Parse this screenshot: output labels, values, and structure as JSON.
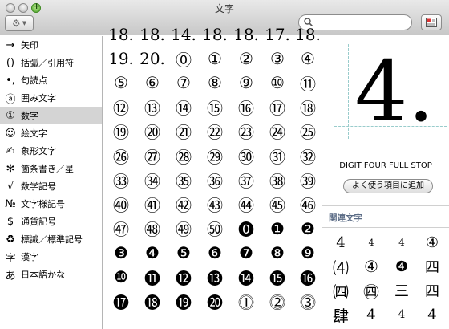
{
  "window": {
    "title": "文字"
  },
  "search": {
    "placeholder": ""
  },
  "sidebar": {
    "items": [
      {
        "icon": "→",
        "label": "矢印"
      },
      {
        "icon": "()",
        "label": "括弧／引用符"
      },
      {
        "icon": "•,",
        "label": "句読点"
      },
      {
        "icon": "ⓐ",
        "label": "囲み文字"
      },
      {
        "icon": "①",
        "label": "数字"
      },
      {
        "icon": "☺",
        "label": "絵文字"
      },
      {
        "icon": "✍",
        "label": "象形文字"
      },
      {
        "icon": "✻",
        "label": "箇条書き／星"
      },
      {
        "icon": "√",
        "label": "数学記号"
      },
      {
        "icon": "№",
        "label": "文字様記号"
      },
      {
        "icon": "$",
        "label": "通貨記号"
      },
      {
        "icon": "♻",
        "label": "標識／標準記号"
      },
      {
        "icon": "字",
        "label": "漢字"
      },
      {
        "icon": "あ",
        "label": "日本語かな"
      }
    ],
    "selected_index": 4
  },
  "char_grid": {
    "rows": [
      [
        "18.",
        "18.",
        "14.",
        "18.",
        "18.",
        "17.",
        "18."
      ],
      [
        "19.",
        "20.",
        "⓪",
        "①",
        "②",
        "③",
        "④"
      ],
      [
        "⑤",
        "⑥",
        "⑦",
        "⑧",
        "⑨",
        "⑩",
        "⑪"
      ],
      [
        "⑫",
        "⑬",
        "⑭",
        "⑮",
        "⑯",
        "⑰",
        "⑱"
      ],
      [
        "⑲",
        "⑳",
        "㉑",
        "㉒",
        "㉓",
        "㉔",
        "㉕"
      ],
      [
        "㉖",
        "㉗",
        "㉘",
        "㉙",
        "㉚",
        "㉛",
        "㉜"
      ],
      [
        "㉝",
        "㉞",
        "㉟",
        "㊱",
        "㊲",
        "㊳",
        "㊴"
      ],
      [
        "㊵",
        "㊶",
        "㊷",
        "㊸",
        "㊹",
        "㊺",
        "㊻"
      ],
      [
        "㊼",
        "㊽",
        "㊾",
        "㊿",
        "⓿",
        "❶",
        "❷"
      ],
      [
        "❸",
        "❹",
        "❺",
        "❻",
        "❼",
        "❽",
        "❾"
      ],
      [
        "❿",
        "⓫",
        "⓬",
        "⓭",
        "⓮",
        "⓯",
        "⓰"
      ],
      [
        "⓱",
        "⓲",
        "⓳",
        "⓴",
        "⓵",
        "⓶",
        "⓷"
      ]
    ]
  },
  "preview": {
    "character": "4.",
    "name": "DIGIT FOUR FULL STOP",
    "add_favorite_label": "よく使う項目に追加"
  },
  "related": {
    "header": "関連文字",
    "rows": [
      [
        "4",
        "4",
        "4",
        "④"
      ],
      [
        "⑷",
        "④",
        "❹",
        "四"
      ],
      [
        "㈣",
        "㊃",
        "三",
        "四"
      ],
      [
        "肆",
        "4",
        "4",
        "4"
      ]
    ]
  }
}
